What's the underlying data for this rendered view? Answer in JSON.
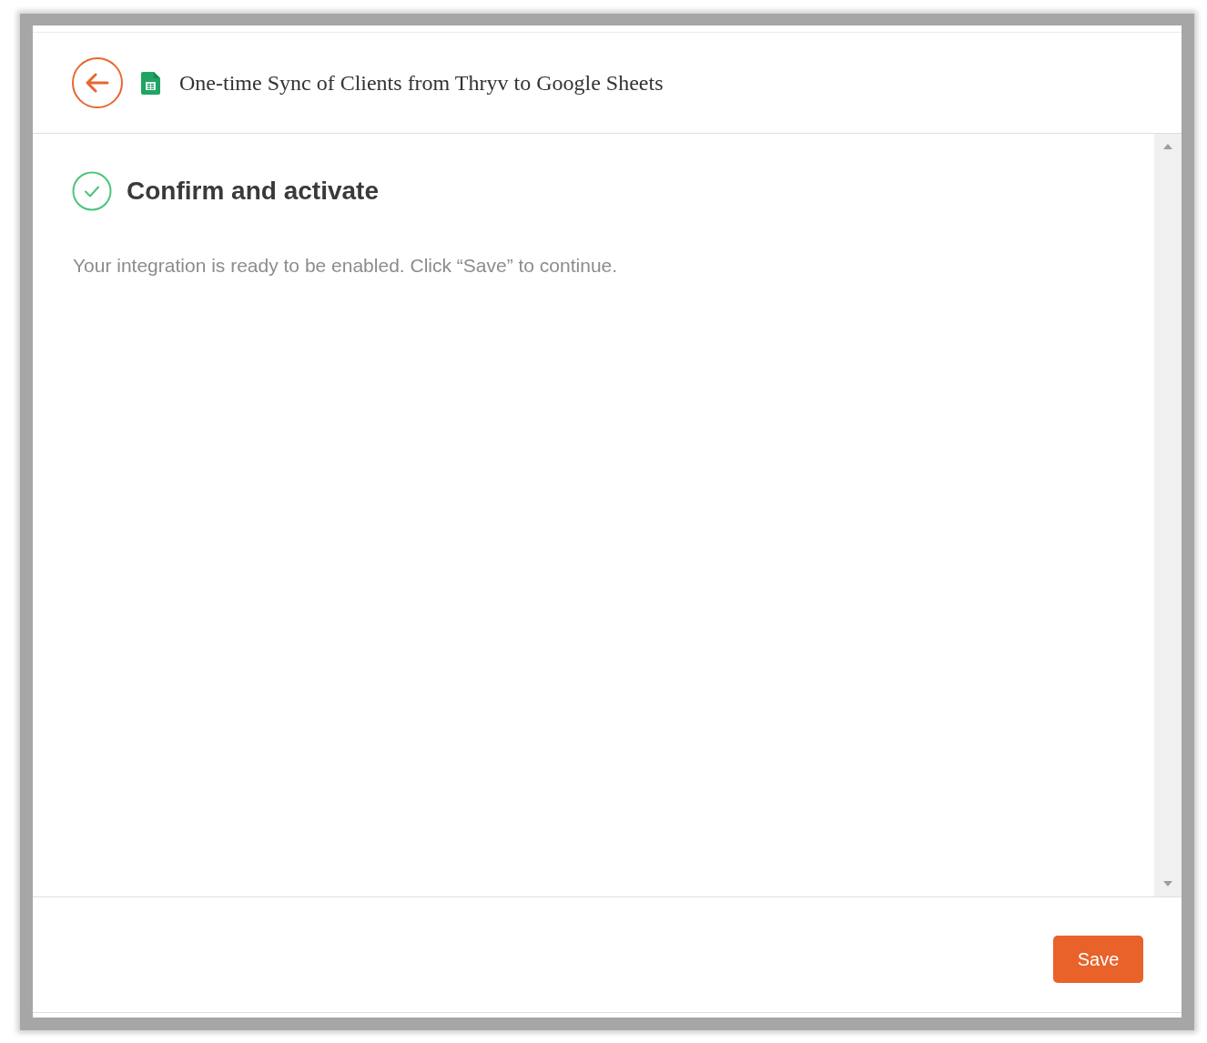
{
  "header": {
    "title": "One-time Sync of Clients from Thryv to Google Sheets"
  },
  "step": {
    "title": "Confirm and activate",
    "completed": true,
    "message": "Your integration is ready to be enabled. Click “Save” to continue."
  },
  "footer": {
    "buttons": [
      {
        "label": "Save",
        "kind": "primary"
      }
    ]
  }
}
